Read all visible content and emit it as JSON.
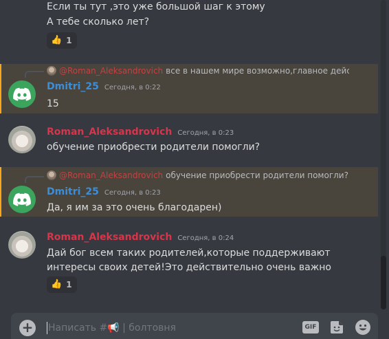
{
  "messages": [
    {
      "lines": [
        "Если ты тут ,это уже большой шаг к этому",
        "А тебе сколько лет?"
      ],
      "reaction": {
        "emoji": "👍",
        "count": "1"
      }
    },
    {
      "reply": {
        "mention": "@Roman_Aleksandrovich",
        "text": "все в нашем мире возможно,главное дейс"
      },
      "username": "Dmitri_25",
      "timestamp": "Сегодня, в 0:22",
      "text": "15",
      "highlighted": true
    },
    {
      "username": "Roman_Aleksandrovich",
      "timestamp": "Сегодня, в 0:23",
      "text": "обучение приобрести родители помогли?"
    },
    {
      "reply": {
        "mention": "@Roman_Aleksandrovich",
        "text": "обучение приобрести родители помогли?"
      },
      "username": "Dmitri_25",
      "timestamp": "Сегодня, в 0:23",
      "text": "Да, я им за это очень благодарен)",
      "highlighted": true
    },
    {
      "username": "Roman_Aleksandrovich",
      "timestamp": "Сегодня, в 0:24",
      "lines": [
        "Дай бог всем таких родителей,которые поддерживают",
        "интересы своих детей!Это действительно очень важно"
      ],
      "reaction": {
        "emoji": "👍",
        "count": "1"
      }
    }
  ],
  "composer": {
    "placeholder": "Написать #📢 | болтовня",
    "gif_label": "GIF"
  },
  "icons": {
    "add": "plus-circle-icon",
    "gif": "gif-icon",
    "sticker": "sticker-icon",
    "emoji": "smile-icon",
    "discord": "discord-logo-icon"
  },
  "colors": {
    "background": "#36393f",
    "highlight": "#49443c",
    "username_blue": "#3d8ed9",
    "username_red": "#d8344a",
    "discord_green": "#3ba55d"
  }
}
